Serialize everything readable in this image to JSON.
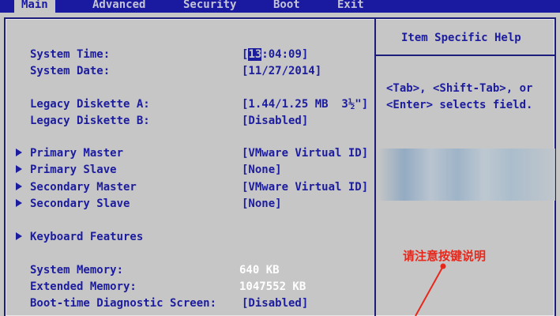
{
  "menu": {
    "tabs": [
      {
        "label": "Main",
        "active": true
      },
      {
        "label": "Advanced",
        "active": false
      },
      {
        "label": "Security",
        "active": false
      },
      {
        "label": "Boot",
        "active": false
      },
      {
        "label": "Exit",
        "active": false
      }
    ]
  },
  "settings": {
    "system_time_label": "System Time:",
    "system_time_hour": "13",
    "system_time_rest": ":04:09]",
    "system_time_open": "[",
    "system_date_label": "System Date:",
    "system_date_value": "[11/27/2014]",
    "diskette_a_label": "Legacy Diskette A:",
    "diskette_a_value": "[1.44/1.25 MB  3½\"]",
    "diskette_b_label": "Legacy Diskette B:",
    "diskette_b_value": "[Disabled]",
    "primary_master_label": "Primary Master",
    "primary_master_value": "[VMware Virtual ID]",
    "primary_slave_label": "Primary Slave",
    "primary_slave_value": "[None]",
    "secondary_master_label": "Secondary Master",
    "secondary_master_value": "[VMware Virtual ID]",
    "secondary_slave_label": "Secondary Slave",
    "secondary_slave_value": "[None]",
    "keyboard_features_label": "Keyboard Features",
    "system_memory_label": "System Memory:",
    "system_memory_value": "640 KB",
    "extended_memory_label": "Extended Memory:",
    "extended_memory_value": "1047552 KB",
    "boot_diag_label": "Boot-time Diagnostic Screen:",
    "boot_diag_value": "[Disabled]"
  },
  "help": {
    "title": "Item Specific Help",
    "line1": "<Tab>, <Shift-Tab>, or",
    "line2": "<Enter> selects field."
  },
  "annotation": {
    "text": "请注意按键说明",
    "color": "#e8281c"
  },
  "colors": {
    "background": "#c6c6c6",
    "menubar": "#1a1aa0",
    "text": "#1c1c9e"
  }
}
